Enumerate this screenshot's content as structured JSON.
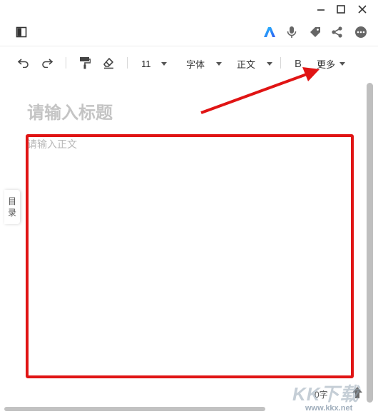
{
  "window": {
    "icons": {
      "minimize": "minimize-icon",
      "maximize": "maximize-icon",
      "close": "close-icon"
    }
  },
  "header": {
    "left_icon": "layout-toggle-icon",
    "right_icons": [
      "ai-assistant-icon",
      "microphone-icon",
      "tag-icon",
      "share-icon",
      "more-options-icon"
    ]
  },
  "toolbar": {
    "font_size": "11",
    "font_family": "字体",
    "paragraph_style": "正文",
    "bold_label": "B",
    "more_label": "更多"
  },
  "editor": {
    "title_placeholder": "请输入标题",
    "body_placeholder": "请输入正文"
  },
  "side_tab": {
    "line1": "目",
    "line2": "录"
  },
  "status": {
    "word_count": "0字"
  },
  "watermark": {
    "logo_text": "KK下载",
    "url": "www.kkx.net"
  },
  "colors": {
    "annotation": "#e01414",
    "accent_blue": "#2f7ff0",
    "icon_gray": "#555555"
  }
}
